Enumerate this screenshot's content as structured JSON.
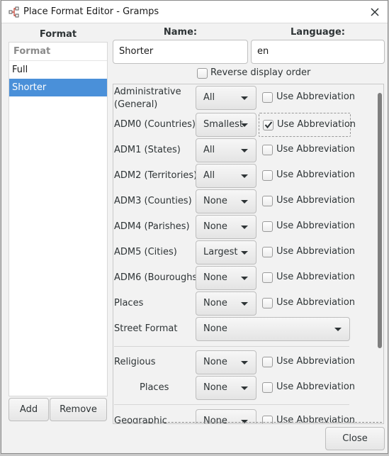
{
  "window": {
    "title": "Place Format Editor - Gramps",
    "close_icon": "close-icon",
    "app_icon": "gramps-tree-icon"
  },
  "formats": {
    "header": "Format",
    "list_header": "Format",
    "items": [
      {
        "label": "Full",
        "selected": false
      },
      {
        "label": "Shorter",
        "selected": true
      }
    ],
    "add_label": "Add",
    "remove_label": "Remove"
  },
  "editor": {
    "name_label": "Name:",
    "name_value": "Shorter",
    "language_label": "Language:",
    "language_value": "en",
    "reverse_label": "Reverse display order",
    "reverse_checked": false,
    "abbr_label": "Use Abbreviation",
    "rows": [
      {
        "label": "Administrative\n(General)",
        "value": "All",
        "abbr": false
      },
      {
        "label": "ADM0 (Countries)",
        "value": "Smallest",
        "abbr": true
      },
      {
        "label": "ADM1 (States)",
        "value": "All",
        "abbr": false
      },
      {
        "label": "ADM2 (Territories)",
        "value": "All",
        "abbr": false
      },
      {
        "label": "ADM3 (Counties)",
        "value": "None",
        "abbr": false
      },
      {
        "label": "ADM4 (Parishes)",
        "value": "None",
        "abbr": false
      },
      {
        "label": "ADM5 (Cities)",
        "value": "Largest",
        "abbr": false
      },
      {
        "label": "ADM6 (Bouroughs)",
        "value": "None",
        "abbr": false
      },
      {
        "label": "Places",
        "value": "None",
        "abbr": false
      }
    ],
    "street_label": "Street Format",
    "street_value": "None",
    "religious_label": "Religious",
    "religious_value": "None",
    "religious_abbr": false,
    "religious_places_label": "Places",
    "religious_places_value": "None",
    "religious_places_abbr": false,
    "geographic_label": "Geographic",
    "geographic_value": "None",
    "geographic_abbr": false
  },
  "close_label": "Close",
  "colors": {
    "selection": "#4a90d9",
    "window_bg": "#f2f2f2"
  }
}
